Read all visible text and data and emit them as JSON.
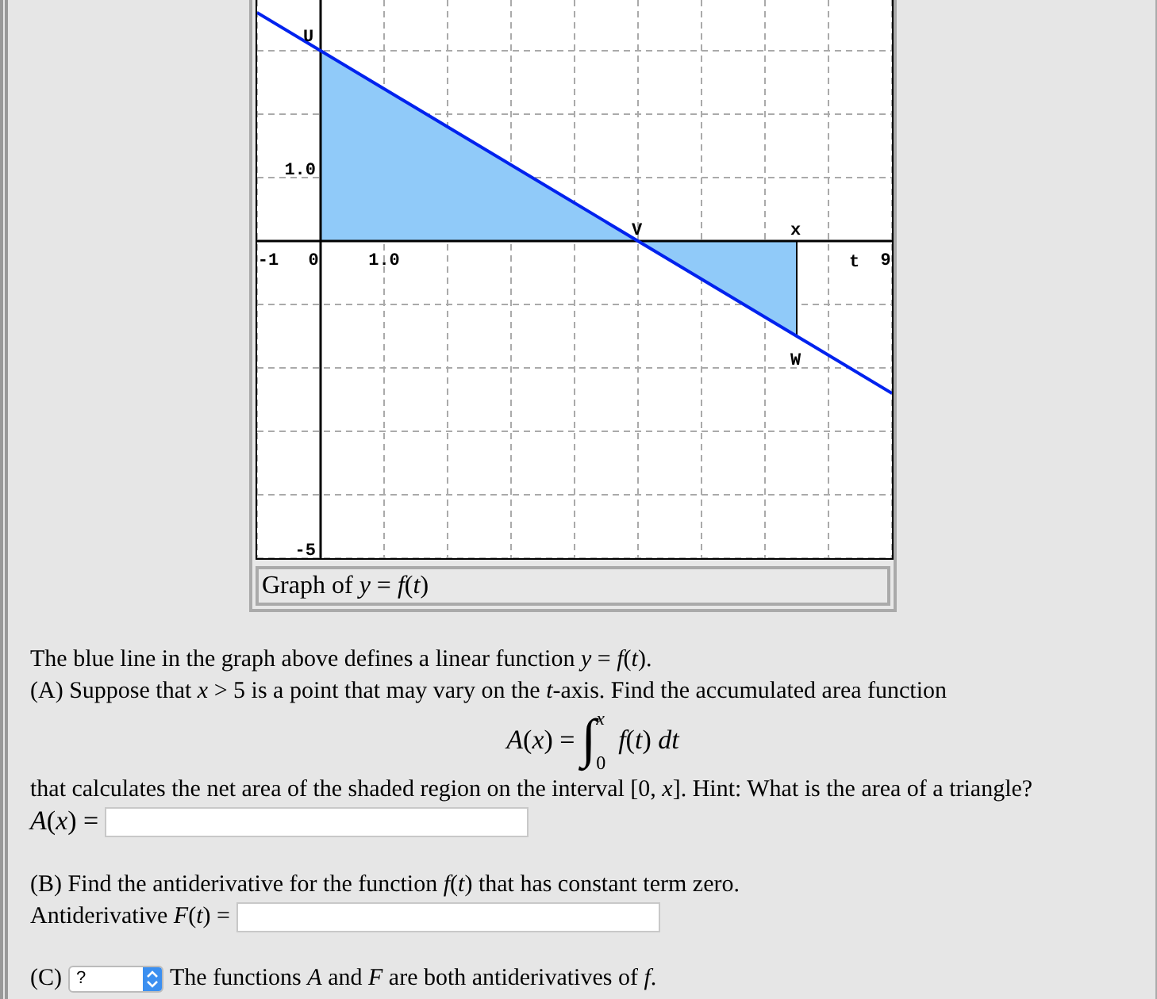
{
  "graph": {
    "caption": "Graph of *y* = *f*(*t*)",
    "chart_data": {
      "type": "line",
      "x": [
        -1,
        9
      ],
      "series": [
        {
          "color": "#0022ee",
          "values": [
            3.6,
            -2.4
          ]
        }
      ],
      "xlim": [
        -1,
        9
      ],
      "ylim": [
        -5,
        3.8
      ],
      "xticks": [
        {
          "value": -1,
          "label": "-1"
        },
        {
          "value": 0,
          "label": "0"
        },
        {
          "value": 1,
          "label": "1.0"
        },
        {
          "value": 9,
          "label": "9"
        }
      ],
      "yticks": [
        {
          "value": 1,
          "label": "1.0"
        },
        {
          "value": -5,
          "label": "-5"
        }
      ],
      "annotations": [
        "U",
        "V",
        "x",
        "W",
        "t"
      ]
    }
  },
  "intro": "The blue line in the graph above defines a linear function *y* = *f*(*t*).",
  "part_a": {
    "text": "(A) Suppose that *x* > 5 is a point that may vary on the *t*-axis. Find the accumulated area function",
    "integral": {
      "lhs": "*A*(*x*) =",
      "sign": "∫",
      "upper": "x",
      "lower": "0",
      "integrand": "*f*(*t*) *dt*"
    },
    "after": "that calculates the net area of the shaded region on the interval [0, *x*]. Hint: What is the area of a triangle?",
    "answer_label": "*A*(*x*) ="
  },
  "part_b": {
    "text": "(B) Find the antiderivative for the function *f*(*t*) that has constant term zero.",
    "answer_label": "Antiderivative *F*(*t*) ="
  },
  "part_c": {
    "label": "(C)",
    "select_value": "?",
    "text": "The functions *A* and *F* are both antiderivatives of *f*."
  }
}
